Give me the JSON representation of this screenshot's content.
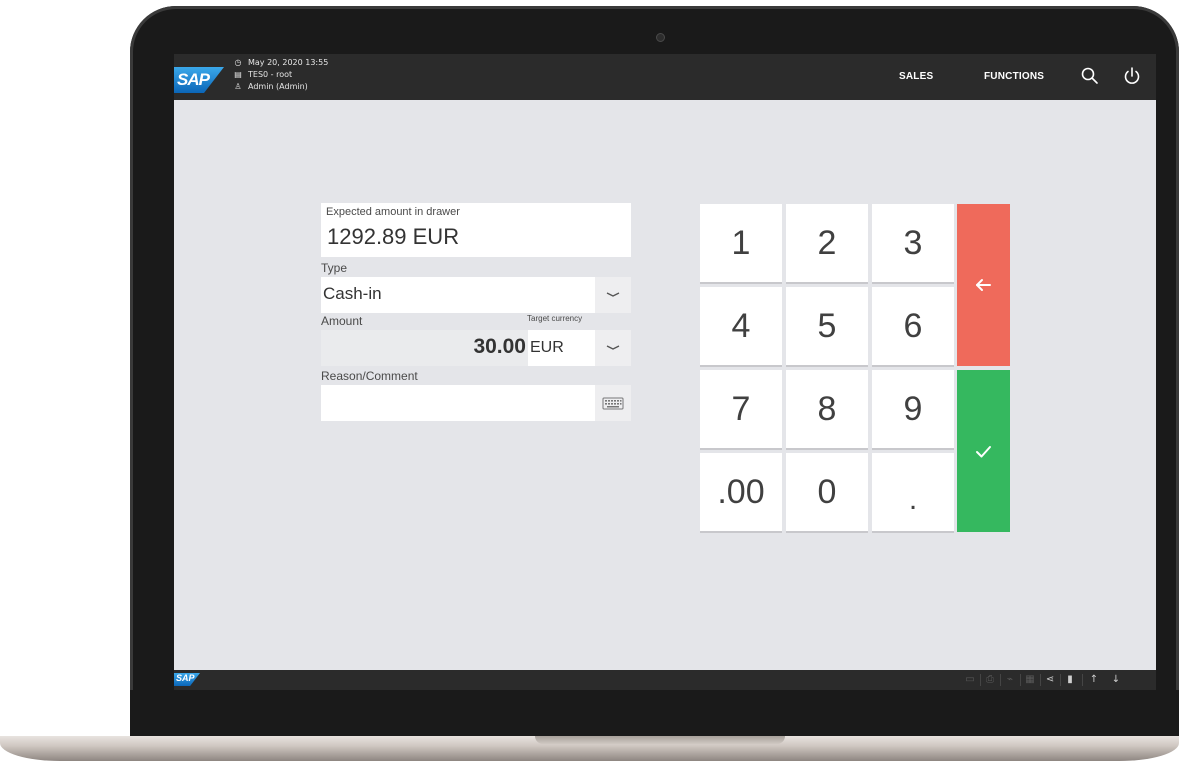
{
  "header": {
    "logo_text": "SAP",
    "datetime": "May 20, 2020 13:55",
    "terminal": "TES0 - root",
    "user": "Admin (Admin)",
    "nav": [
      "SALES",
      "FUNCTIONS"
    ]
  },
  "form": {
    "expected_label": "Expected amount in drawer",
    "expected_value": "1292.89 EUR",
    "type_label": "Type",
    "type_value": "Cash-in",
    "amount_label": "Amount",
    "target_currency_label": "Target currency",
    "amount_value": "30.00",
    "currency_value": "EUR",
    "reason_label": "Reason/Comment",
    "reason_value": ""
  },
  "keypad": {
    "keys": [
      "1",
      "2",
      "3",
      "4",
      "5",
      "6",
      "7",
      "8",
      "9",
      ".00",
      "0",
      "."
    ],
    "back_symbol": "←",
    "confirm_symbol": "✓"
  },
  "statusbar": {
    "logo_text": "SAP"
  },
  "colors": {
    "header_bg": "#2b2b2b",
    "screen_bg": "#e4e5e9",
    "backspace": "#ef6a5b",
    "confirm": "#35b85f",
    "sap_blue": "#0b66b8"
  }
}
